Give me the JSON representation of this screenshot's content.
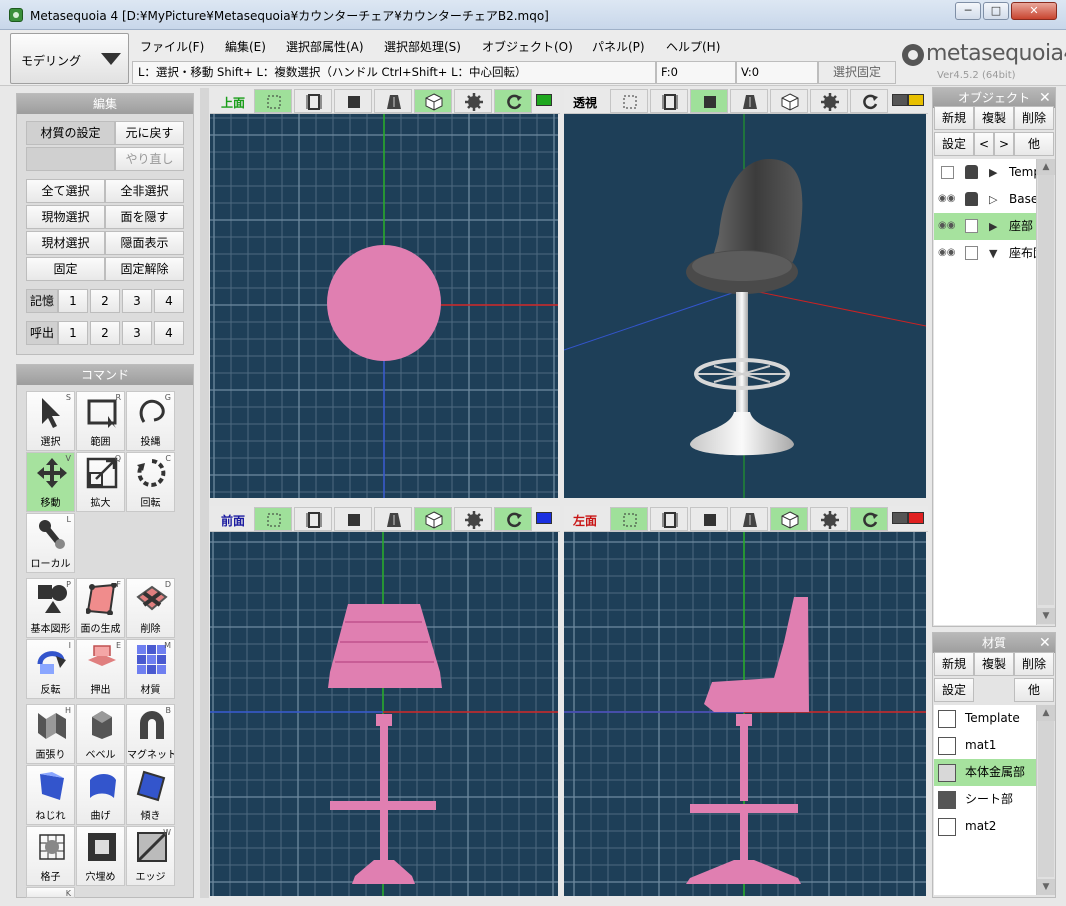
{
  "window": {
    "title": "Metasequoia 4 [D:¥MyPicture¥Metasequoia¥カウンターチェア¥カウンターチェアB2.mqo]",
    "minimize": "─",
    "maximize": "□",
    "close": "✕"
  },
  "mode": {
    "label": "モデリング"
  },
  "menu": [
    "ファイル(F)",
    "編集(E)",
    "選択部属性(A)",
    "選択部処理(S)",
    "オブジェクト(O)",
    "パネル(P)",
    "ヘルプ(H)"
  ],
  "status": {
    "hint": "L：選択・移動  Shift+ L：複数選択（ハンドル  Ctrl+Shift+ L：中心回転）",
    "faces": "F:0",
    "vertices": "V:0",
    "selection_fix": "選択固定"
  },
  "logo": {
    "text": "metasequoia4",
    "version": "Ver4.5.2 (64bit)"
  },
  "edit_panel": {
    "title": "編集",
    "material_setting": "材質の設定",
    "undo": "元に戻す",
    "redo": "やり直し",
    "select_all": "全て選択",
    "deselect_all": "全非選択",
    "select_current_object": "現物選択",
    "hide_faces": "面を隠す",
    "select_current_material": "現材選択",
    "show_hidden": "隠面表示",
    "lock": "固定",
    "unlock": "固定解除",
    "memory_label": "記憶",
    "recall_label": "呼出",
    "slots": [
      "1",
      "2",
      "3",
      "4"
    ]
  },
  "command_panel": {
    "title": "コマンド",
    "commands": [
      {
        "label": "選択",
        "key": "S",
        "icon": "cursor-icon"
      },
      {
        "label": "範囲",
        "key": "R",
        "icon": "range-icon"
      },
      {
        "label": "投縄",
        "key": "G",
        "icon": "lasso-icon"
      },
      {
        "label": "移動",
        "key": "V",
        "icon": "move-icon",
        "active": true
      },
      {
        "label": "拡大",
        "key": "Q",
        "icon": "scale-icon"
      },
      {
        "label": "回転",
        "key": "C",
        "icon": "rotate-icon"
      },
      {
        "label": "ローカル",
        "key": "L",
        "icon": "local-icon"
      },
      {
        "label": "基本図形",
        "key": "P",
        "icon": "primitive-icon"
      },
      {
        "label": "面の生成",
        "key": "F",
        "icon": "face-create-icon"
      },
      {
        "label": "削除",
        "key": "D",
        "icon": "delete-icon"
      },
      {
        "label": "反転",
        "key": "I",
        "icon": "flip-icon"
      },
      {
        "label": "押出",
        "key": "E",
        "icon": "extrude-icon"
      },
      {
        "label": "材質",
        "key": "M",
        "icon": "material-icon"
      },
      {
        "label": "面張り",
        "key": "H",
        "icon": "face-fill-icon"
      },
      {
        "label": "ベベル",
        "key": "",
        "icon": "bevel-icon"
      },
      {
        "label": "マグネット",
        "key": "B",
        "icon": "magnet-icon"
      },
      {
        "label": "ねじれ",
        "key": "",
        "icon": "twist-icon"
      },
      {
        "label": "曲げ",
        "key": "",
        "icon": "bend-icon"
      },
      {
        "label": "傾き",
        "key": "",
        "icon": "tilt-icon"
      },
      {
        "label": "格子",
        "key": "",
        "icon": "lattice-icon"
      },
      {
        "label": "穴埋め",
        "key": "",
        "icon": "hole-fill-icon"
      },
      {
        "label": "エッジ",
        "key": "W",
        "icon": "edge-icon"
      },
      {
        "label": "",
        "key": "K",
        "icon": "knife-icon"
      }
    ]
  },
  "viewports": {
    "top": {
      "title": "上面",
      "title_color": "#1a9e1a"
    },
    "perspective": {
      "title": "透視",
      "title_color": "#000000"
    },
    "front": {
      "title": "前面",
      "title_color": "#1a1aa0"
    },
    "left": {
      "title": "左面",
      "title_color": "#c81414"
    }
  },
  "object_panel": {
    "title": "オブジェクト",
    "new": "新規",
    "duplicate": "複製",
    "delete": "削除",
    "settings": "設定",
    "prev": "<",
    "next": ">",
    "other": "他",
    "objects": [
      {
        "name": "Template",
        "visible": false,
        "locked": true,
        "expander": "collapsed"
      },
      {
        "name": "Base",
        "visible": true,
        "locked": true,
        "expander": "empty"
      },
      {
        "name": "座部",
        "visible": true,
        "locked": false,
        "expander": "collapsed",
        "selected": true
      },
      {
        "name": "座布団",
        "visible": true,
        "locked": false,
        "expander": "expanded"
      }
    ]
  },
  "material_panel": {
    "title": "材質",
    "new": "新規",
    "duplicate": "複製",
    "delete": "削除",
    "settings": "設定",
    "other": "他",
    "materials": [
      {
        "name": "Template",
        "color": "#ffffff"
      },
      {
        "name": "mat1",
        "color": "#ffffff"
      },
      {
        "name": "本体金属部",
        "color": "#d8d8d8",
        "selected": true
      },
      {
        "name": "シート部",
        "color": "#555555"
      },
      {
        "name": "mat2",
        "color": "#ffffff"
      }
    ]
  },
  "colors": {
    "viewport_bg": "#1e3f58",
    "mesh_pink": "#e07fb1",
    "active_green": "#9fe09a",
    "axis_x": "#cc2222",
    "axis_y": "#22aa22",
    "axis_z": "#3355cc"
  }
}
